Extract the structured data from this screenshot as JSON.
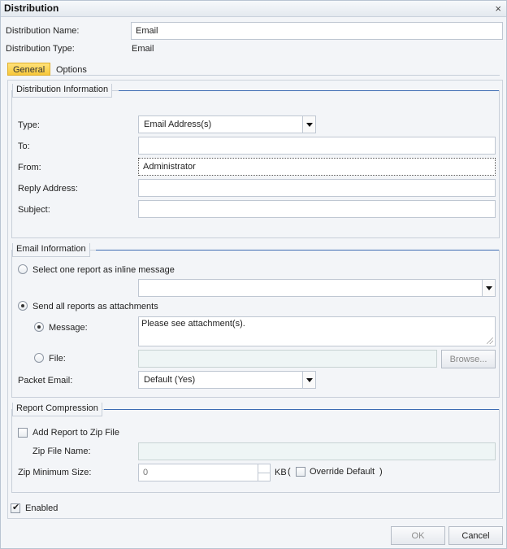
{
  "window": {
    "title": "Distribution",
    "close_glyph": "×"
  },
  "header": {
    "name_label": "Distribution Name:",
    "name_value": "Email",
    "type_label": "Distribution Type:",
    "type_value": "Email"
  },
  "tabs": [
    {
      "label": "General",
      "active": true
    },
    {
      "label": "Options",
      "active": false
    }
  ],
  "distribution_info": {
    "legend": "Distribution Information",
    "type_label": "Type:",
    "type_value": "Email Address(s)",
    "to_label": "To:",
    "to_value": "",
    "from_label": "From:",
    "from_value": "Administrator",
    "reply_label": "Reply Address:",
    "reply_value": "",
    "subject_label": "Subject:",
    "subject_value": ""
  },
  "email_info": {
    "legend": "Email Information",
    "inline_label": "Select one report as inline message",
    "inline_selected": false,
    "inline_report_value": "",
    "attach_label": "Send all reports as attachments",
    "attach_selected": true,
    "message_label": "Message:",
    "message_selected": true,
    "message_value": "Please see attachment(s).",
    "file_label": "File:",
    "file_selected": false,
    "file_value": "",
    "browse_label": "Browse...",
    "packet_label": "Packet Email:",
    "packet_value": "Default (Yes)"
  },
  "compression": {
    "legend": "Report Compression",
    "zip_label": "Add Report to Zip File",
    "zip_checked": false,
    "zip_name_label": "Zip File Name:",
    "zip_name_value": "",
    "min_size_label": "Zip Minimum Size:",
    "min_size_value": "0",
    "unit_label": "KB",
    "paren_open": "(",
    "override_label": "Override Default",
    "override_checked": false,
    "paren_close": ")"
  },
  "enabled": {
    "label": "Enabled",
    "checked": true
  },
  "footer": {
    "ok_label": "OK",
    "cancel_label": "Cancel"
  },
  "colors": {
    "accent_line": "#3d6cb3",
    "active_tab": "#f7c73a",
    "disabled_field": "#eef5f5"
  }
}
